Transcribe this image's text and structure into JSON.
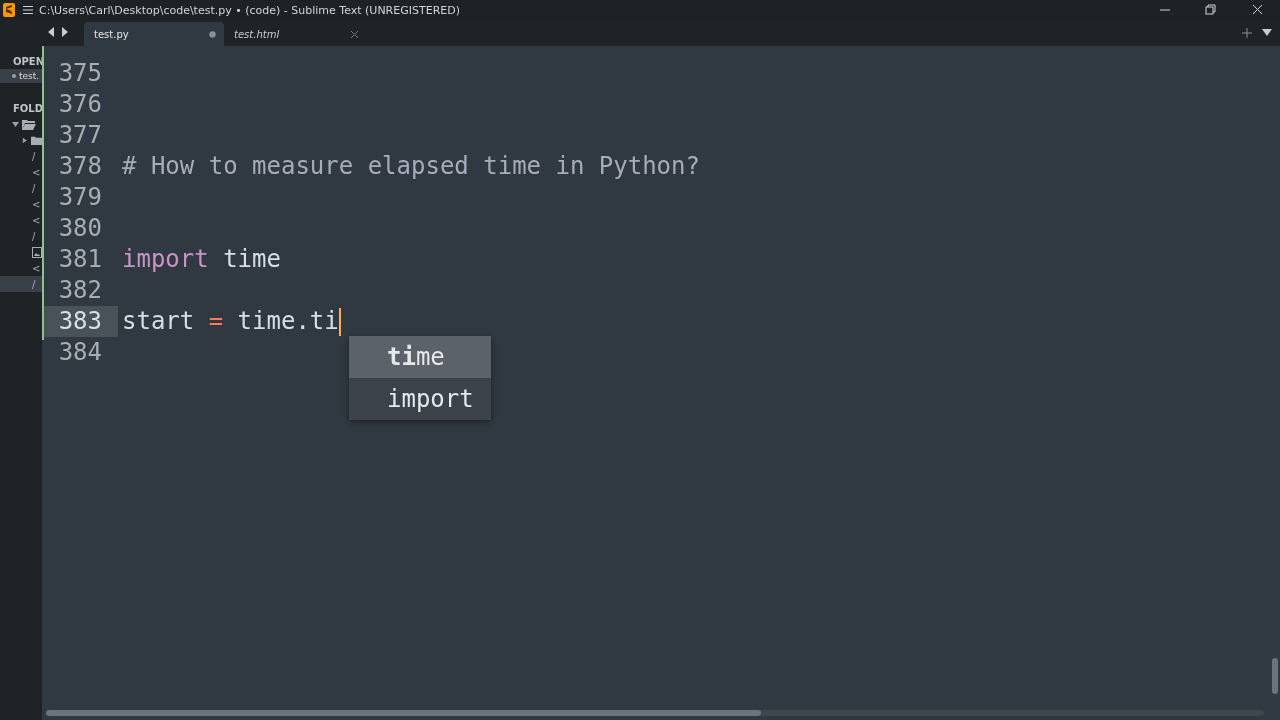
{
  "window": {
    "title": "C:\\Users\\Carl\\Desktop\\code\\test.py • (code) - Sublime Text (UNREGISTERED)"
  },
  "sidebar": {
    "open_header": "OPEN",
    "open_files": [
      {
        "label": "test.",
        "selected": true
      }
    ],
    "folders_header": "FOLD",
    "tree": [
      {
        "kind": "folder",
        "expanded": true,
        "selected": false,
        "children": [
          {
            "kind": "folder",
            "expanded": false,
            "selected": false
          },
          {
            "kind": "file",
            "label": "/",
            "selected": false
          },
          {
            "kind": "file",
            "label": "<",
            "selected": false
          },
          {
            "kind": "file",
            "label": "/",
            "selected": false
          },
          {
            "kind": "file",
            "label": "<",
            "selected": false
          },
          {
            "kind": "file",
            "label": "<",
            "selected": false
          },
          {
            "kind": "file",
            "label": "/",
            "selected": false
          },
          {
            "kind": "image",
            "selected": false
          },
          {
            "kind": "file",
            "label": "<",
            "selected": false
          },
          {
            "kind": "file",
            "label": "/",
            "selected": true
          }
        ]
      }
    ]
  },
  "tabs": [
    {
      "label": "test.py",
      "selected": true,
      "dirty": true,
      "transient": false
    },
    {
      "label": "test.html",
      "selected": false,
      "dirty": false,
      "transient": true
    }
  ],
  "editor": {
    "lines": [
      {
        "number": "375",
        "current": false
      },
      {
        "number": "376",
        "current": false
      },
      {
        "number": "377",
        "current": false
      },
      {
        "number": "378",
        "current": false,
        "tokens": [
          {
            "kind": "comment",
            "text": "# How to measure elapsed time in Python?"
          }
        ]
      },
      {
        "number": "379",
        "current": false
      },
      {
        "number": "380",
        "current": false
      },
      {
        "number": "381",
        "current": false,
        "tokens": [
          {
            "kind": "keyword",
            "text": "import"
          },
          {
            "kind": "plain",
            "text": " time"
          }
        ]
      },
      {
        "number": "382",
        "current": false
      },
      {
        "number": "383",
        "current": true,
        "cursor": true,
        "tokens": [
          {
            "kind": "plain",
            "text": "start "
          },
          {
            "kind": "operator",
            "text": "="
          },
          {
            "kind": "plain",
            "text": " time.ti"
          }
        ]
      },
      {
        "number": "384",
        "current": false
      }
    ]
  },
  "autocomplete": {
    "items": [
      {
        "label": "**ti**me",
        "selected": true
      },
      {
        "label": "import",
        "selected": false
      }
    ]
  }
}
